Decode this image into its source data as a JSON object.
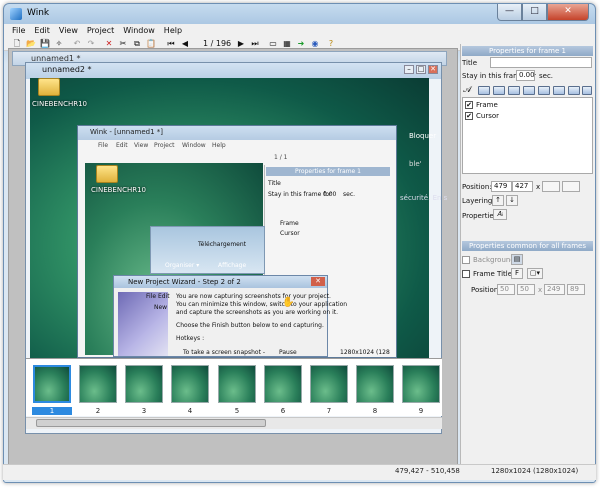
{
  "window": {
    "title": "Wink",
    "minimize": "—",
    "maximize": "□",
    "close": "✕"
  },
  "menu": [
    "File",
    "Edit",
    "View",
    "Project",
    "Window",
    "Help"
  ],
  "toolbar": {
    "frame_counter": "1 / 196",
    "icons": [
      "new-icon",
      "open-icon",
      "save-icon",
      "wand-icon",
      "undo-icon",
      "redo-icon",
      "delete-icon",
      "cut-icon",
      "copy-icon",
      "paste-icon",
      "first-frame-icon",
      "prev-frame-icon",
      "next-frame-icon",
      "last-frame-icon",
      "frame-icon",
      "export-icon",
      "render-icon",
      "preview-icon",
      "help-icon"
    ]
  },
  "child_windows": {
    "back_title": "unnamed1 *",
    "front_title": "unnamed2 *"
  },
  "canvas": {
    "desktop_icon_label": "CINEBENCHR10",
    "inner_window_title": "Wink - [unnamed1 *]",
    "inner_menu": [
      "File",
      "Edit",
      "View",
      "Project",
      "Window",
      "Help"
    ],
    "inner_frame_counter": "1 / 1",
    "inner_properties_head": "Properties for frame 1",
    "inner_title_label": "Title",
    "inner_stay_label": "Stay in this frame for",
    "inner_stay_value": "0.00",
    "inner_sec": "sec.",
    "inner_layer_frame": "Frame",
    "inner_layer_cursor": "Cursor",
    "inner_resolution": "1280x1024 (128",
    "explorer_crumb": "Téléchargement",
    "explorer_organize": "Organiser ▾",
    "explorer_display": "Affichage",
    "bg_text_1": "Bloquer",
    "bg_text_2": "ble'",
    "bg_text_3": "sécurité. En s",
    "wizard": {
      "title": "New Project Wizard - Step 2 of 2",
      "menu_file": "File",
      "menu_edit": "Edit",
      "menu_new": "New",
      "line1": "You are now capturing screenshots for your project.",
      "line2": "You can minimize this window, switch to your application",
      "line3": "and capture the screenshots as you are working on it.",
      "line4": "Choose the Finish button below to end capturing.",
      "line5": "Hotkeys :",
      "line6": "To take a screen snapshot -",
      "line6_key": "Pause"
    }
  },
  "filmstrip": {
    "frames": [
      "1",
      "2",
      "3",
      "4",
      "5",
      "6",
      "7",
      "8",
      "9"
    ],
    "selected": "1"
  },
  "properties": {
    "frame_section_title": "Properties for frame 1",
    "title_label": "Title",
    "title_value": "",
    "stay_label": "Stay in this frame for",
    "stay_value": "0.00",
    "sec_label": "sec.",
    "layers": [
      {
        "name": "Frame",
        "checked": "✔"
      },
      {
        "name": "Cursor",
        "checked": "✔"
      }
    ],
    "position_label": "Position:",
    "position_x": "479",
    "position_y": "427",
    "x_sep": "x",
    "layering_label": "Layering:",
    "properties_label": "Properties:",
    "common_section_title": "Properties common for all frames",
    "background_label": "Background",
    "frame_titles_label": "Frame Titles",
    "font_btn": "F",
    "common_position_label": "Position:",
    "common_pos": [
      "50",
      "50",
      "249",
      "89"
    ],
    "common_x": "x"
  },
  "status": {
    "coords": "479,427 - 510,458",
    "resolution": "1280x1024 (1280x1024)"
  }
}
